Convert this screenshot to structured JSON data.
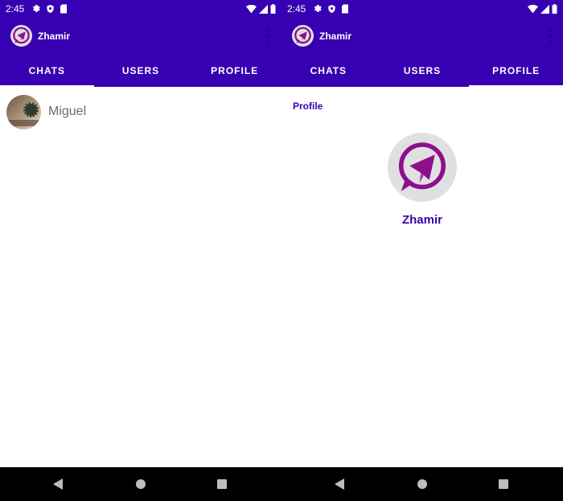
{
  "status_bar": {
    "time": "2:45"
  },
  "app_bar": {
    "title": "Zhamir"
  },
  "tabs": [
    {
      "label": "CHATS"
    },
    {
      "label": "USERS"
    },
    {
      "label": "PROFILE"
    }
  ],
  "screens": [
    {
      "active_tab": "CHATS"
    },
    {
      "active_tab": "PROFILE"
    }
  ],
  "chats": [
    {
      "name": "Miguel"
    }
  ],
  "profile": {
    "section_label": "Profile",
    "name": "Zhamir"
  },
  "colors": {
    "primary": "#3700b3",
    "accent_logo": "#8e0f8e",
    "white": "#ffffff",
    "nav_bar": "#000000"
  },
  "icons": [
    "settings-gear-icon",
    "shield-icon",
    "sd-card-icon",
    "wifi-icon",
    "signal-icon",
    "battery-icon",
    "telegram-logo-icon",
    "more-vert-icon",
    "back-icon",
    "home-icon",
    "recents-icon"
  ]
}
